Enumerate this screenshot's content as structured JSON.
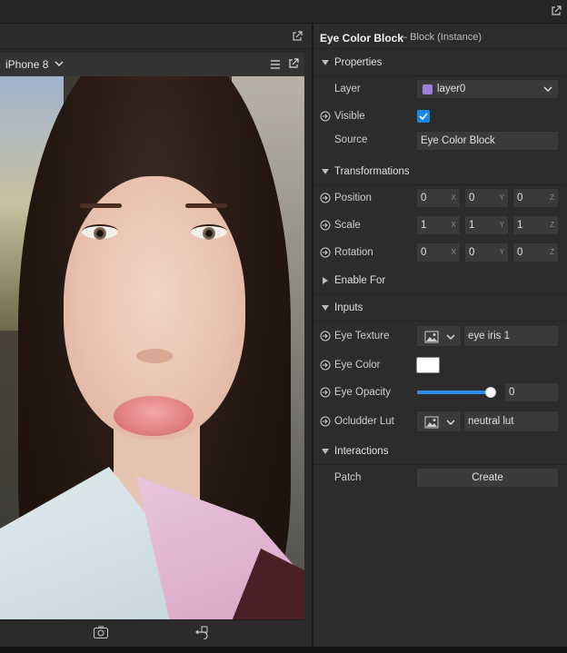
{
  "viewport": {
    "device_label": "iPhone 8",
    "preview_image": "portrait-camera-preview"
  },
  "inspector": {
    "title": "Eye Color Block",
    "subtitle": "– Block (Instance)",
    "sections": {
      "properties": "Properties",
      "transformations": "Transformations",
      "enable_for": "Enable For",
      "inputs": "Inputs",
      "interactions": "Interactions"
    },
    "properties": {
      "layer_label": "Layer",
      "layer_value": "layer0",
      "visible_label": "Visible",
      "visible_checked": true,
      "source_label": "Source",
      "source_value": "Eye Color Block"
    },
    "transformations": {
      "position": {
        "label": "Position",
        "x": "0",
        "y": "0",
        "z": "0"
      },
      "scale": {
        "label": "Scale",
        "x": "1",
        "y": "1",
        "z": "1"
      },
      "rotation": {
        "label": "Rotation",
        "x": "0",
        "y": "0",
        "z": "0"
      },
      "axis_labels": {
        "x": "X",
        "y": "Y",
        "z": "Z"
      }
    },
    "inputs": {
      "eye_texture_label": "Eye Texture",
      "eye_texture_value": "eye iris 1",
      "eye_color_label": "Eye Color",
      "eye_color_value": "#ffffff",
      "eye_opacity_label": "Eye Opacity",
      "eye_opacity_value": "0",
      "eye_opacity_slider_fraction": 1.0,
      "occluder_label": "Ocludder Lut",
      "occluder_value": "neutral lut"
    },
    "interactions": {
      "patch_label": "Patch",
      "create_label": "Create"
    }
  },
  "colors": {
    "accent": "#1a86e8",
    "layer_swatch": "#9b7fd8"
  }
}
